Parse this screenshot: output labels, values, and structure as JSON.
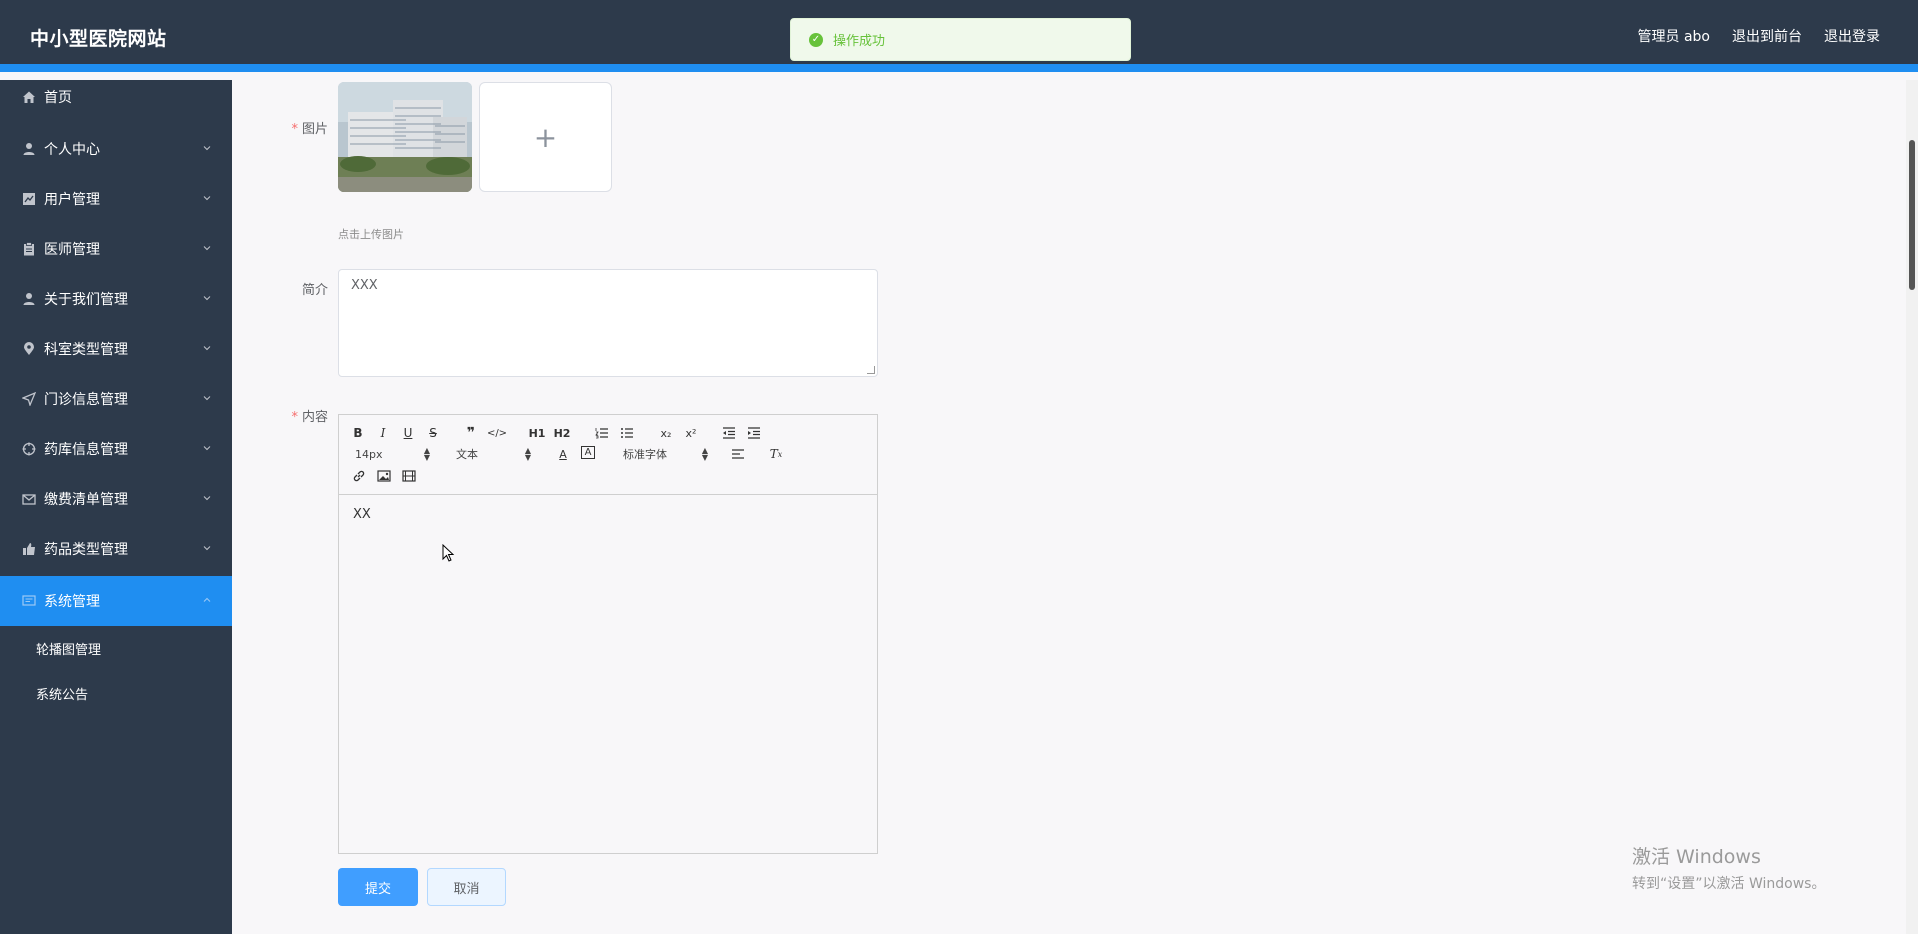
{
  "header": {
    "brand": "中小型医院网站",
    "admin_label": "管理员 abo",
    "front_label": "退出到前台",
    "logout_label": "退出登录"
  },
  "toast": {
    "message": "操作成功",
    "icon": "check-circle-icon",
    "color": "#67c23a"
  },
  "sidebar": {
    "items": [
      {
        "label": "首页",
        "icon": "home-icon"
      },
      {
        "label": "个人中心",
        "icon": "user-icon"
      },
      {
        "label": "用户管理",
        "icon": "chart-icon"
      },
      {
        "label": "医师管理",
        "icon": "clipboard-icon"
      },
      {
        "label": "关于我们管理",
        "icon": "user-icon"
      },
      {
        "label": "科室类型管理",
        "icon": "location-icon"
      },
      {
        "label": "门诊信息管理",
        "icon": "send-icon"
      },
      {
        "label": "药库信息管理",
        "icon": "aim-icon"
      },
      {
        "label": "缴费清单管理",
        "icon": "mail-icon"
      },
      {
        "label": "药品类型管理",
        "icon": "thumb-icon"
      },
      {
        "label": "系统管理",
        "icon": "screen-icon",
        "active": true
      }
    ],
    "sub_items": [
      {
        "label": "轮播图管理"
      },
      {
        "label": "系统公告"
      }
    ]
  },
  "form": {
    "image_label": "图片",
    "upload_hint": "点击上传图片",
    "intro_label": "简介",
    "intro_value": "XXX",
    "content_label": "内容",
    "content_value": "XX",
    "submit_label": "提交",
    "cancel_label": "取消"
  },
  "editor_toolbar": {
    "h1": "H1",
    "h2": "H2",
    "sub": "x₂",
    "sup": "x²",
    "size": "14px",
    "header": "文本",
    "font": "标准字体"
  },
  "watermark": {
    "line1": "激活 Windows",
    "line2": "转到“设置”以激活 Windows。"
  },
  "colors": {
    "sidebar_bg": "#2d3a4b",
    "accent": "#1f8ef1",
    "primary_button": "#409eff",
    "required": "#f56c6c"
  }
}
